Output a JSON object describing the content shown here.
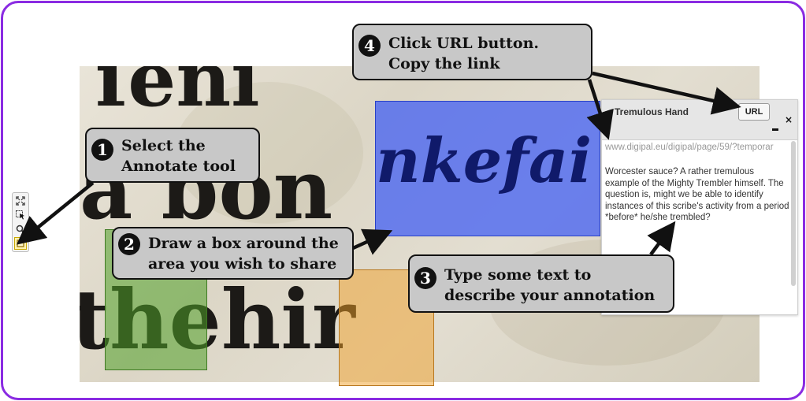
{
  "panel": {
    "title": "Tremulous Hand",
    "url_button": "URL",
    "close": "×",
    "url": "www.digipal.eu/digipal/page/59/?temporar",
    "note": "Worcester sauce? A rather tremulous example of the Mighty Trembler himself. The question is, might we be able to identify instances of this scribe's activity from a period *before* he/she trembled?"
  },
  "callouts": [
    {
      "number": "1",
      "line1": "Select the",
      "line2": "Annotate tool"
    },
    {
      "number": "2",
      "line1": "Draw a box around the",
      "line2": "area you wish to share"
    },
    {
      "number": "3",
      "line1": "Type some text to",
      "line2": "describe your annotation"
    },
    {
      "number": "4",
      "line1": "Click URL button.",
      "line2": "Copy the link"
    }
  ],
  "toolbar": {
    "tools": [
      {
        "icon": "fullscreen-icon"
      },
      {
        "icon": "select-pointer-icon"
      },
      {
        "icon": "zoom-icon"
      },
      {
        "icon": "annotate-rectangle-icon",
        "active": true
      }
    ]
  },
  "colors": {
    "frame": "#8a2be2",
    "annotation_blue": "#3c5af5",
    "annotation_green": "#50a028",
    "annotation_orange": "#f0a028",
    "callout_bg": "#c8c8c8"
  }
}
